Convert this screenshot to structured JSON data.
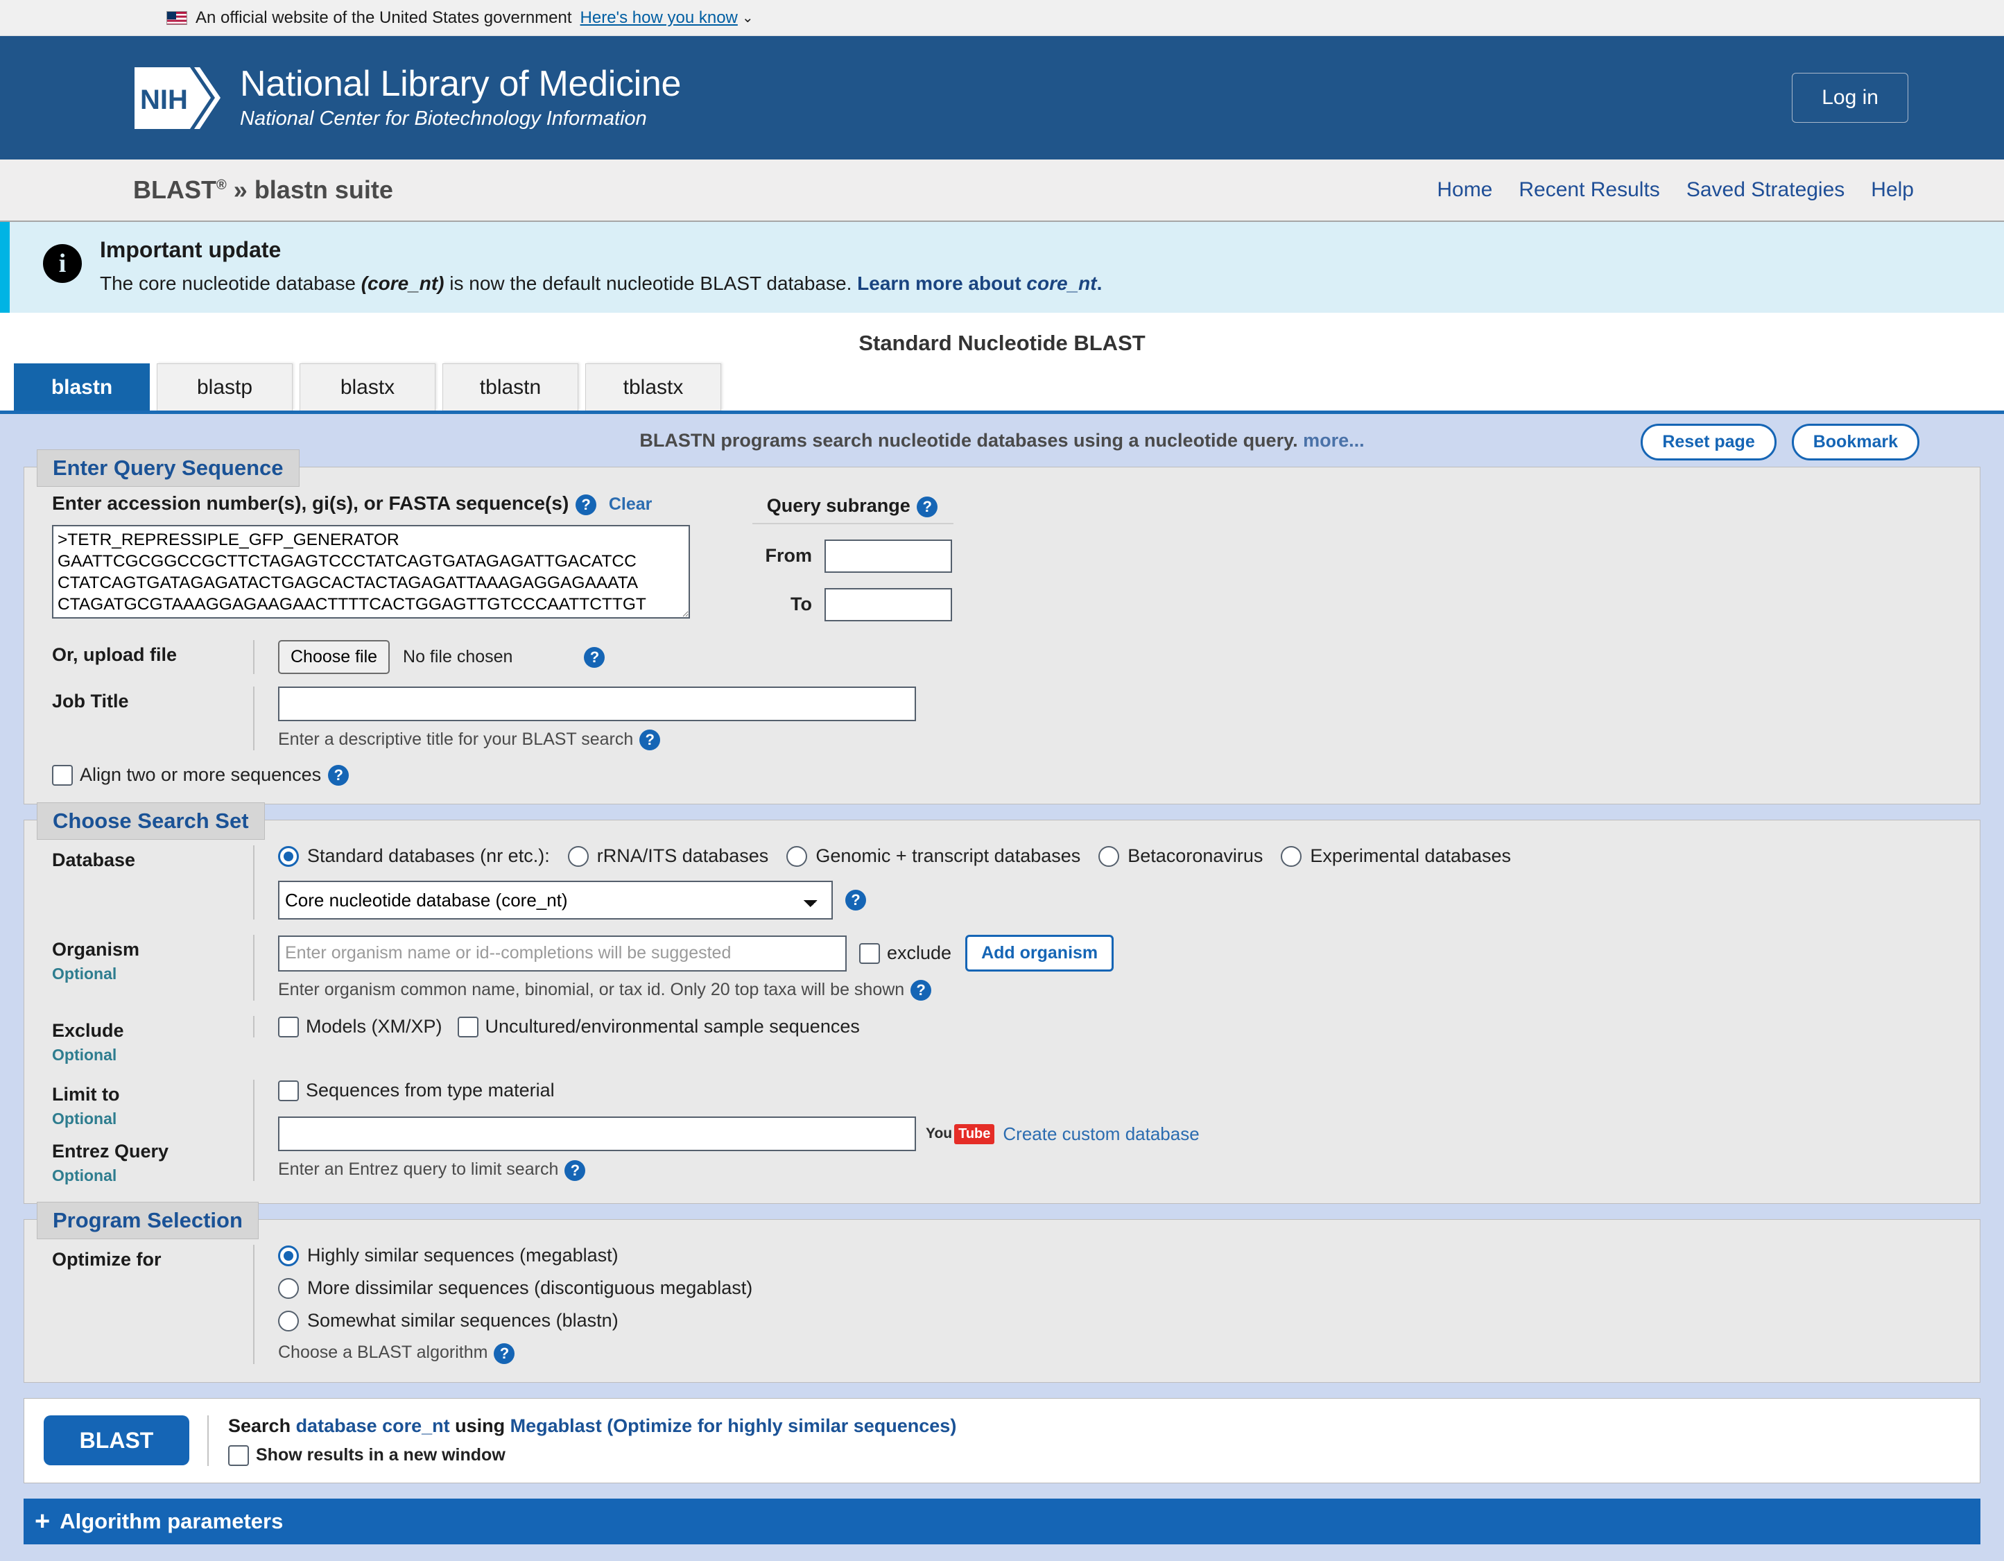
{
  "gov_banner": {
    "text": "An official website of the United States government",
    "link": "Here's how you know",
    "chevron": "⌄"
  },
  "header": {
    "org_main": "National Library of Medicine",
    "org_sub": "National Center for Biotechnology Information",
    "logo_text": "NIH",
    "login": "Log in"
  },
  "breadcrumb": {
    "product": "BLAST",
    "registered": "®",
    "separator": "»",
    "suite": "blastn suite",
    "nav": [
      {
        "label": "Home"
      },
      {
        "label": "Recent Results"
      },
      {
        "label": "Saved Strategies"
      },
      {
        "label": "Help"
      }
    ]
  },
  "notice": {
    "icon": "i",
    "heading": "Important update",
    "body_pre": "The core nucleotide database ",
    "body_em": "(core_nt)",
    "body_mid": " is now the default nucleotide BLAST database. ",
    "link_pre": "Learn more about ",
    "link_em": "core_nt",
    "link_post": "."
  },
  "page_title": "Standard Nucleotide BLAST",
  "tabs": [
    {
      "label": "blastn",
      "active": true
    },
    {
      "label": "blastp",
      "active": false
    },
    {
      "label": "blastx",
      "active": false
    },
    {
      "label": "tblastn",
      "active": false
    },
    {
      "label": "tblastx",
      "active": false
    }
  ],
  "program_description": {
    "text": "BLASTN programs search nucleotide databases using a nucleotide query.",
    "more": "more..."
  },
  "page_actions": {
    "reset": "Reset page",
    "bookmark": "Bookmark"
  },
  "query_section": {
    "legend": "Enter Query Sequence",
    "query_label": "Enter accession number(s), gi(s), or FASTA sequence(s)",
    "clear": "Clear",
    "sequence_value": ">TETR_REPRESSIPLE_GFP_GENERATOR\nGAATTCGCGGCCGCTTCTAGAGTCCCTATCAGTGATAGAGATTGACATCC\nCTATCAGTGATAGAGATACTGAGCACTACTAGAGATTAAAGAGGAGAAATA\nCTAGATGCGTAAAGGAGAAGAACTTTTCACTGGAGTTGTCCCAATTCTTGT",
    "subrange_title": "Query subrange",
    "from_label": "From",
    "from_value": "",
    "to_label": "To",
    "to_value": "",
    "upload_label": "Or, upload file",
    "choose_file": "Choose file",
    "no_file": "No file chosen",
    "job_title_label": "Job Title",
    "job_title_value": "",
    "job_title_hint": "Enter a descriptive title for your BLAST search",
    "align_two_label": "Align two or more sequences",
    "align_two_checked": false
  },
  "search_set": {
    "legend": "Choose Search Set",
    "database_label": "Database",
    "database_options": [
      {
        "label": "Standard databases (nr etc.):",
        "selected": true
      },
      {
        "label": "rRNA/ITS databases",
        "selected": false
      },
      {
        "label": "Genomic + transcript databases",
        "selected": false
      },
      {
        "label": "Betacoronavirus",
        "selected": false
      },
      {
        "label": "Experimental databases",
        "selected": false
      }
    ],
    "database_select_value": "Core nucleotide database (core_nt)",
    "organism_label": "Organism",
    "optional": "Optional",
    "organism_placeholder": "Enter organism name or id--completions will be suggested",
    "organism_value": "",
    "exclude_checkbox_label": "exclude",
    "add_organism": "Add organism",
    "organism_hint": "Enter organism common name, binomial, or tax id. Only 20 top taxa will be shown",
    "exclude_label": "Exclude",
    "exclude_models": "Models (XM/XP)",
    "exclude_uncultured": "Uncultured/environmental sample sequences",
    "limit_to_label": "Limit to",
    "limit_type_material": "Sequences from type material",
    "entrez_label": "Entrez Query",
    "entrez_value": "",
    "entrez_hint": "Enter an Entrez query to limit search",
    "youtube_you": "You",
    "youtube_tube": "Tube",
    "custom_db_link": "Create custom database"
  },
  "program_selection": {
    "legend": "Program Selection",
    "optimize_label": "Optimize for",
    "options": [
      {
        "label": "Highly similar sequences (megablast)",
        "selected": true
      },
      {
        "label": "More dissimilar sequences (discontiguous megablast)",
        "selected": false
      },
      {
        "label": "Somewhat similar sequences (blastn)",
        "selected": false
      }
    ],
    "hint": "Choose a BLAST algorithm"
  },
  "submit": {
    "blast_button": "BLAST",
    "search_pre": "Search ",
    "database_link": "database core_nt",
    "using": " using ",
    "program_link": "Megablast (Optimize for highly similar sequences)",
    "new_window_label": "Show results in a new window",
    "new_window_checked": false,
    "algorithm_parameters": "Algorithm parameters",
    "algorithm_plus": "+"
  },
  "colors": {
    "nih_blue": "#20558a",
    "accent_blue": "#1565b5",
    "page_blue": "#ccd8f0",
    "notice_bg": "#daeff7",
    "notice_accent": "#00b4e4"
  }
}
